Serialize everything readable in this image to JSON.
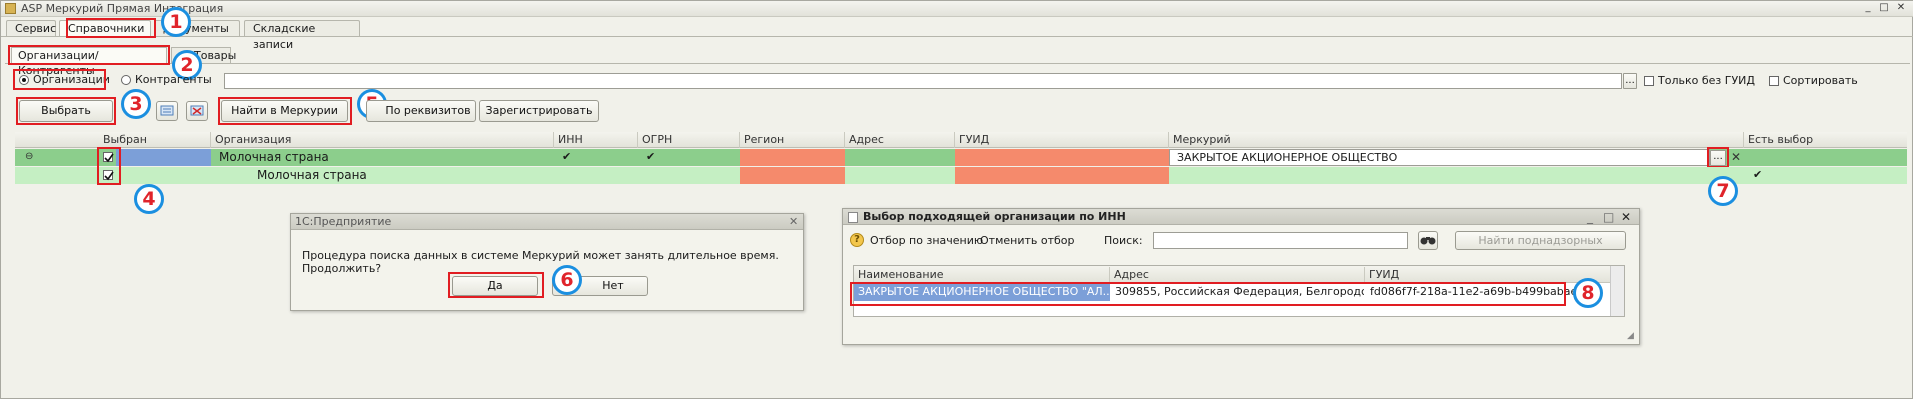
{
  "window": {
    "title": "ASP Меркурий Прямая Интеграция"
  },
  "main_tabs": [
    {
      "label": "Сервис"
    },
    {
      "label": "Справочники"
    },
    {
      "label": "Документы"
    },
    {
      "label": "Складские записи"
    }
  ],
  "sub_tabs": [
    {
      "label": "Организации/Контрагенты"
    },
    {
      "label": "Товары"
    }
  ],
  "filters": {
    "radio_org": "Организации",
    "radio_contr": "Контрагенты",
    "only_no_guid": "Только без ГУИД",
    "sort": "Сортировать",
    "search_value": "",
    "dots": "..."
  },
  "toolbar": {
    "select": "Выбрать",
    "find_mercury": "Найти в Меркурии",
    "by_requisites": "По реквизитов",
    "register": "Зарегистрировать"
  },
  "table": {
    "columns": [
      "Выбран",
      "Организация",
      "ИНН",
      "ОГРН",
      "Регион",
      "Адрес",
      "ГУИД",
      "Меркурий",
      "Есть выбор"
    ],
    "rows": [
      {
        "org": "Молочная страна",
        "inn": "✔",
        "ogrn": "✔",
        "mercury": "ЗАКРЫТОЕ АКЦИОНЕРНОЕ ОБЩЕСТВО",
        "has_choice": ""
      },
      {
        "org": "Молочная страна",
        "inn": "",
        "ogrn": "",
        "mercury": "",
        "has_choice": "✔"
      }
    ],
    "collapse_glyph": "⊖"
  },
  "confirm_dialog": {
    "title": "1С:Предприятие",
    "message": "Процедура поиска данных в системе Меркурий может занять длительное время. Продолжить?",
    "yes": "Да",
    "no": "Нет"
  },
  "inn_dialog": {
    "title": "Выбор подходящей организации по ИНН",
    "filter_by_value": "Отбор по значению",
    "cancel_filter": "Отменить отбор",
    "search_label": "Поиск:",
    "search_value": "",
    "find_subordinates": "Найти поднадзорных",
    "columns": [
      "Наименование",
      "Адрес",
      "ГУИД"
    ],
    "row": {
      "name": "ЗАКРЫТОЕ АКЦИОНЕРНОЕ ОБЩЕСТВО \"АЛ...",
      "address": "309855, Российская Федерация, Белгородск...",
      "guid": "fd086f7f-218a-11e2-a69b-b499babae"
    }
  },
  "markers": [
    "1",
    "2",
    "3",
    "4",
    "5",
    "6",
    "7",
    "8"
  ],
  "colors": {
    "highlight_red": "#e11d22",
    "marker_blue": "#1b8fe0",
    "marker_text": "#e0242b",
    "row_green": "#8cce8c",
    "row_light_green": "#c5efc3",
    "cell_orange": "#f58a6c",
    "cell_blue": "#7c9fd8"
  }
}
